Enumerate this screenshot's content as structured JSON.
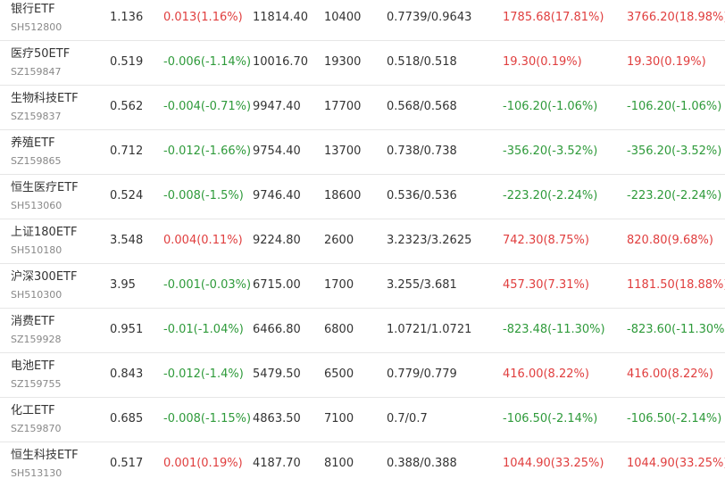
{
  "colors": {
    "up": "#e03e3e",
    "down": "#2e9a3a",
    "text": "#333333",
    "code": "#888888",
    "divider": "#e6e6e6"
  },
  "rows": [
    {
      "name": "银行ETF",
      "code": "SH512800",
      "price": "1.136",
      "change": "0.013(1.16%)",
      "change_dir": "up",
      "value": "11814.40",
      "shares": "10400",
      "cost": "0.7739/0.9643",
      "profit1": "1785.68(17.81%)",
      "profit1_dir": "up",
      "profit2": "3766.20(18.98%)",
      "profit2_dir": "up"
    },
    {
      "name": "医疗50ETF",
      "code": "SZ159847",
      "price": "0.519",
      "change": "-0.006(-1.14%)",
      "change_dir": "down",
      "value": "10016.70",
      "shares": "19300",
      "cost": "0.518/0.518",
      "profit1": "19.30(0.19%)",
      "profit1_dir": "up",
      "profit2": "19.30(0.19%)",
      "profit2_dir": "up"
    },
    {
      "name": "生物科技ETF",
      "code": "SZ159837",
      "price": "0.562",
      "change": "-0.004(-0.71%)",
      "change_dir": "down",
      "value": "9947.40",
      "shares": "17700",
      "cost": "0.568/0.568",
      "profit1": "-106.20(-1.06%)",
      "profit1_dir": "down",
      "profit2": "-106.20(-1.06%)",
      "profit2_dir": "down"
    },
    {
      "name": "养殖ETF",
      "code": "SZ159865",
      "price": "0.712",
      "change": "-0.012(-1.66%)",
      "change_dir": "down",
      "value": "9754.40",
      "shares": "13700",
      "cost": "0.738/0.738",
      "profit1": "-356.20(-3.52%)",
      "profit1_dir": "down",
      "profit2": "-356.20(-3.52%)",
      "profit2_dir": "down"
    },
    {
      "name": "恒生医疗ETF",
      "code": "SH513060",
      "price": "0.524",
      "change": "-0.008(-1.5%)",
      "change_dir": "down",
      "value": "9746.40",
      "shares": "18600",
      "cost": "0.536/0.536",
      "profit1": "-223.20(-2.24%)",
      "profit1_dir": "down",
      "profit2": "-223.20(-2.24%)",
      "profit2_dir": "down"
    },
    {
      "name": "上证180ETF",
      "code": "SH510180",
      "price": "3.548",
      "change": "0.004(0.11%)",
      "change_dir": "up",
      "value": "9224.80",
      "shares": "2600",
      "cost": "3.2323/3.2625",
      "profit1": "742.30(8.75%)",
      "profit1_dir": "up",
      "profit2": "820.80(9.68%)",
      "profit2_dir": "up"
    },
    {
      "name": "沪深300ETF",
      "code": "SH510300",
      "price": "3.95",
      "change": "-0.001(-0.03%)",
      "change_dir": "down",
      "value": "6715.00",
      "shares": "1700",
      "cost": "3.255/3.681",
      "profit1": "457.30(7.31%)",
      "profit1_dir": "up",
      "profit2": "1181.50(18.88%)",
      "profit2_dir": "up"
    },
    {
      "name": "消费ETF",
      "code": "SZ159928",
      "price": "0.951",
      "change": "-0.01(-1.04%)",
      "change_dir": "down",
      "value": "6466.80",
      "shares": "6800",
      "cost": "1.0721/1.0721",
      "profit1": "-823.48(-11.30%)",
      "profit1_dir": "down",
      "profit2": "-823.60(-11.30%)",
      "profit2_dir": "down"
    },
    {
      "name": "电池ETF",
      "code": "SZ159755",
      "price": "0.843",
      "change": "-0.012(-1.4%)",
      "change_dir": "down",
      "value": "5479.50",
      "shares": "6500",
      "cost": "0.779/0.779",
      "profit1": "416.00(8.22%)",
      "profit1_dir": "up",
      "profit2": "416.00(8.22%)",
      "profit2_dir": "up"
    },
    {
      "name": "化工ETF",
      "code": "SZ159870",
      "price": "0.685",
      "change": "-0.008(-1.15%)",
      "change_dir": "down",
      "value": "4863.50",
      "shares": "7100",
      "cost": "0.7/0.7",
      "profit1": "-106.50(-2.14%)",
      "profit1_dir": "down",
      "profit2": "-106.50(-2.14%)",
      "profit2_dir": "down"
    },
    {
      "name": "恒生科技ETF",
      "code": "SH513130",
      "price": "0.517",
      "change": "0.001(0.19%)",
      "change_dir": "up",
      "value": "4187.70",
      "shares": "8100",
      "cost": "0.388/0.388",
      "profit1": "1044.90(33.25%)",
      "profit1_dir": "up",
      "profit2": "1044.90(33.25%)",
      "profit2_dir": "up"
    }
  ]
}
